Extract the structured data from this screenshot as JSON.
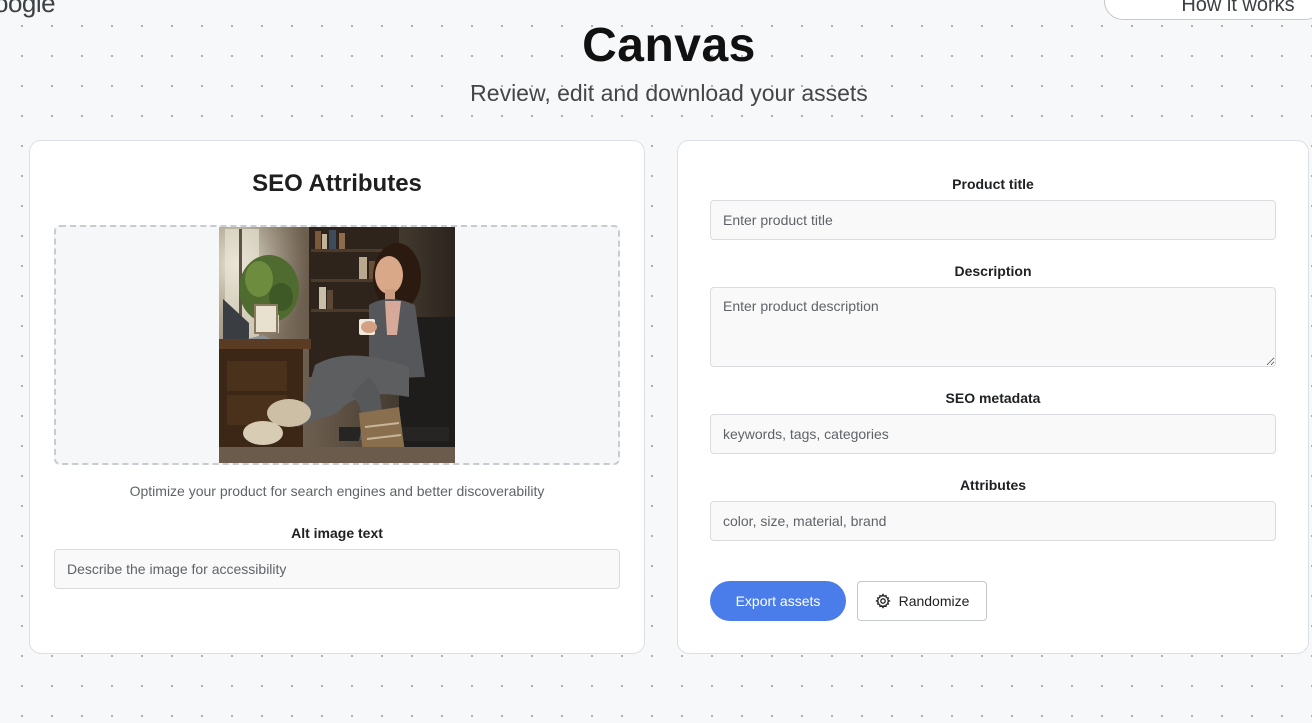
{
  "header": {
    "logo_text": "oogle",
    "how_button_label": "How it works",
    "title": "Canvas",
    "subtitle": "Review, edit and download your assets"
  },
  "seo_card": {
    "title": "SEO Attributes",
    "image_alt": "Woman sitting in an office chair by a desk and bookshelf, holding a mug",
    "helper_text": "Optimize your product for search engines and better discoverability",
    "alt_label": "Alt image text",
    "alt_placeholder": "Describe the image for accessibility"
  },
  "form": {
    "product_title": {
      "label": "Product title",
      "placeholder": "Enter product title"
    },
    "description": {
      "label": "Description",
      "placeholder": "Enter product description"
    },
    "seo_metadata": {
      "label": "SEO metadata",
      "placeholder": "keywords, tags, categories"
    },
    "attributes": {
      "label": "Attributes",
      "placeholder": "color, size, material, brand"
    }
  },
  "actions": {
    "export_label": "Export assets",
    "randomize_label": "Randomize",
    "randomize_icon": "gear-icon"
  },
  "colors": {
    "primary": "#4a7de9",
    "background": "#f7f8fa",
    "card": "#ffffff",
    "border": "#dcdfe3"
  }
}
